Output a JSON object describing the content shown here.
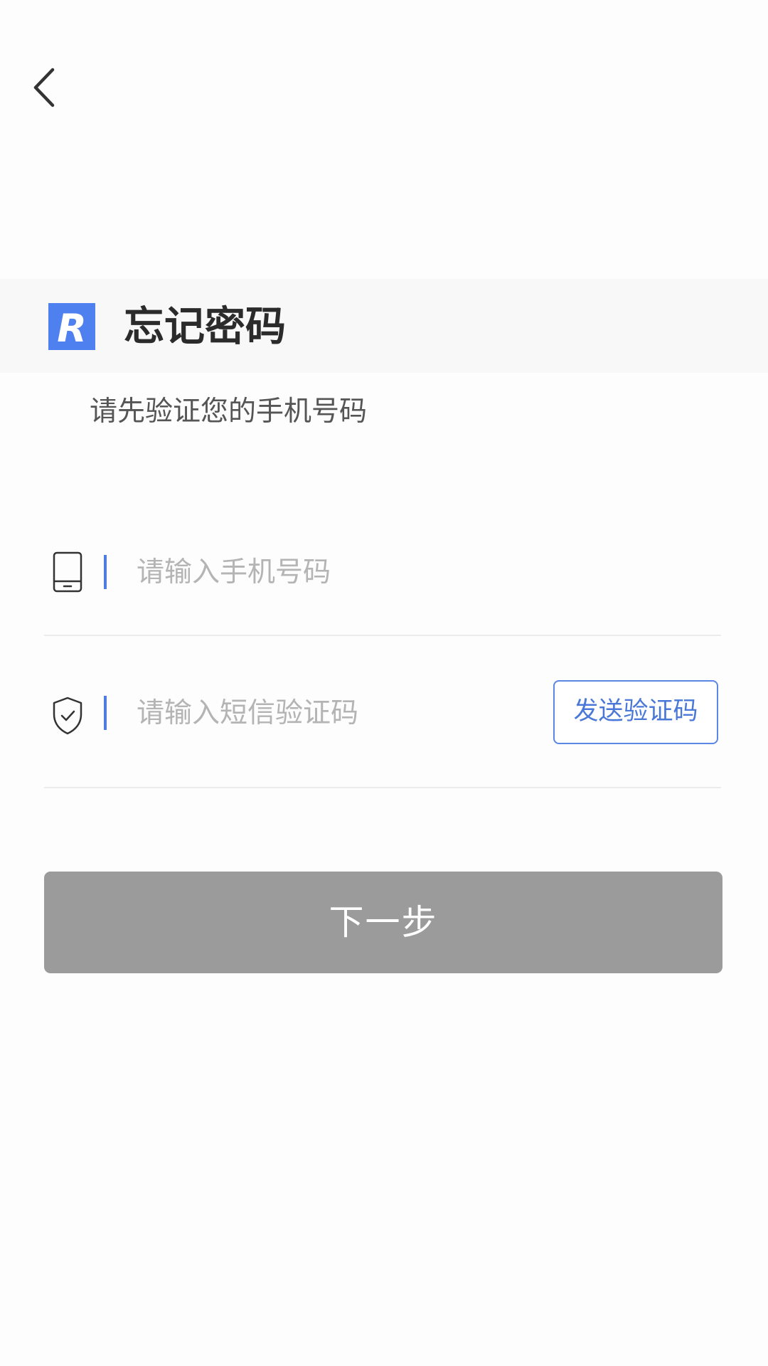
{
  "header": {
    "back_icon": "chevron-left-icon"
  },
  "title_block": {
    "logo_letter": "R",
    "title": "忘记密码",
    "subtitle": "请先验证您的手机号码"
  },
  "form": {
    "phone": {
      "icon": "mobile-phone-icon",
      "placeholder": "请输入手机号码",
      "value": ""
    },
    "code": {
      "icon": "shield-check-icon",
      "placeholder": "请输入短信验证码",
      "value": "",
      "send_button_label": "发送验证码"
    },
    "next_button_label": "下一步"
  },
  "colors": {
    "accent": "#4f7ce0",
    "logo_blue": "#4f80f0",
    "disabled_button": "#9b9b9b",
    "placeholder": "#b4b4b4"
  }
}
